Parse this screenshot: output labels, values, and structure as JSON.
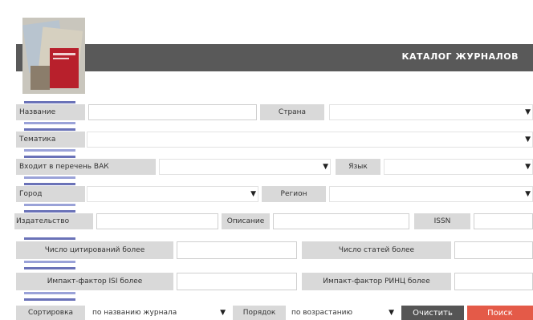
{
  "header": {
    "title": "КАТАЛОГ ЖУРНАЛОВ"
  },
  "fields": {
    "name_label": "Название",
    "country_label": "Страна",
    "topic_label": "Тематика",
    "vak_label": "Входит в перечень ВАК",
    "language_label": "Язык",
    "city_label": "Город",
    "region_label": "Регион",
    "publisher_label": "Издательство",
    "description_label": "Описание",
    "issn_label": "ISSN",
    "citations_label": "Число цитирований более",
    "articles_label": "Число статей более",
    "isi_label": "Импакт-фактор ISI более",
    "rinc_label": "Импакт-фактор РИНЦ более"
  },
  "bottom": {
    "sort_label": "Сортировка",
    "sort_value": "по названию журнала",
    "order_label": "Порядок",
    "order_value": "по возрастанию",
    "clear_button": "Очистить",
    "search_button": "Поиск"
  },
  "icons": {
    "dropdown": "▼"
  },
  "colors": {
    "header_bg": "#595959",
    "search_button": "#e45a48",
    "clear_button": "#555555",
    "stripe": "#6a72b8"
  }
}
